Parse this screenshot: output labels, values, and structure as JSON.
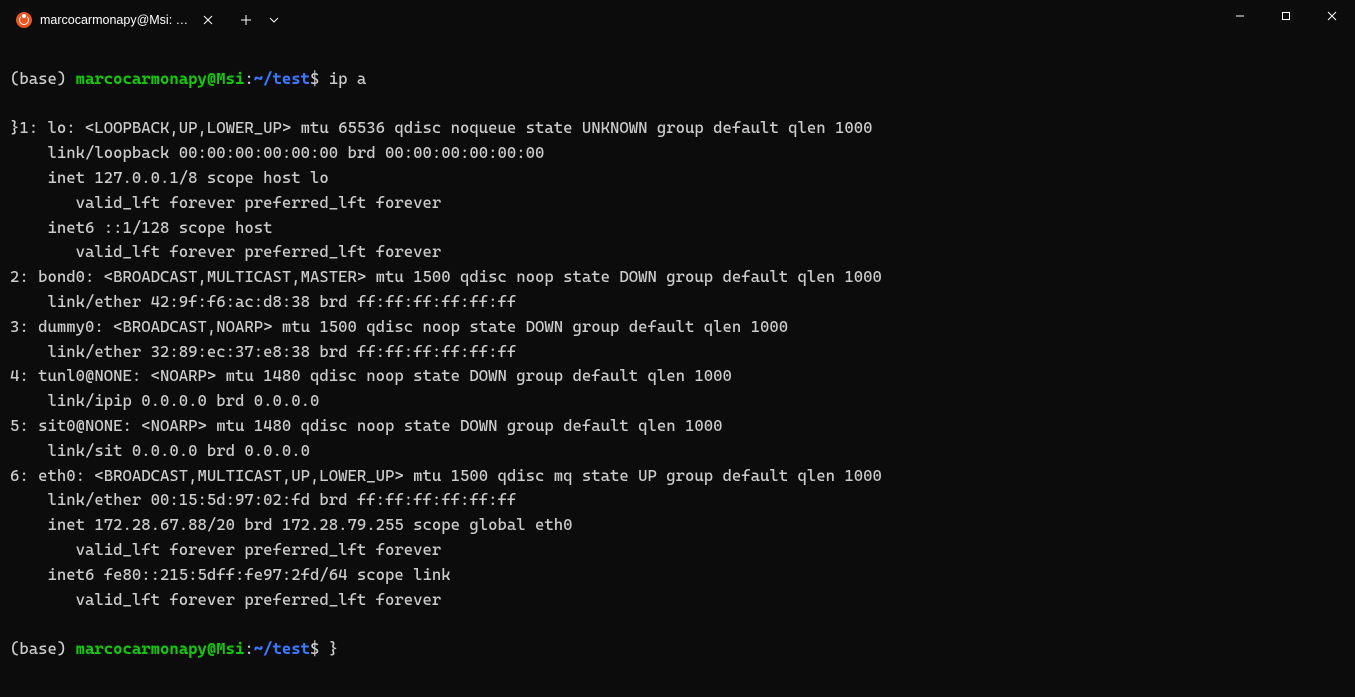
{
  "titlebar": {
    "tab_title": "marcocarmonapy@Msi: ~/tes"
  },
  "prompt1": {
    "base": "(base) ",
    "userhost": "marcocarmonapy@Msi",
    "colon": ":",
    "path": "~/test",
    "dollar": "$ ",
    "command": "ip a"
  },
  "output_lines": [
    "}1: lo: <LOOPBACK,UP,LOWER_UP> mtu 65536 qdisc noqueue state UNKNOWN group default qlen 1000",
    "    link/loopback 00:00:00:00:00:00 brd 00:00:00:00:00:00",
    "    inet 127.0.0.1/8 scope host lo",
    "       valid_lft forever preferred_lft forever",
    "    inet6 ::1/128 scope host",
    "       valid_lft forever preferred_lft forever",
    "2: bond0: <BROADCAST,MULTICAST,MASTER> mtu 1500 qdisc noop state DOWN group default qlen 1000",
    "    link/ether 42:9f:f6:ac:d8:38 brd ff:ff:ff:ff:ff:ff",
    "3: dummy0: <BROADCAST,NOARP> mtu 1500 qdisc noop state DOWN group default qlen 1000",
    "    link/ether 32:89:ec:37:e8:38 brd ff:ff:ff:ff:ff:ff",
    "4: tunl0@NONE: <NOARP> mtu 1480 qdisc noop state DOWN group default qlen 1000",
    "    link/ipip 0.0.0.0 brd 0.0.0.0",
    "5: sit0@NONE: <NOARP> mtu 1480 qdisc noop state DOWN group default qlen 1000",
    "    link/sit 0.0.0.0 brd 0.0.0.0",
    "6: eth0: <BROADCAST,MULTICAST,UP,LOWER_UP> mtu 1500 qdisc mq state UP group default qlen 1000",
    "    link/ether 00:15:5d:97:02:fd brd ff:ff:ff:ff:ff:ff",
    "    inet 172.28.67.88/20 brd 172.28.79.255 scope global eth0",
    "       valid_lft forever preferred_lft forever",
    "    inet6 fe80::215:5dff:fe97:2fd/64 scope link",
    "       valid_lft forever preferred_lft forever"
  ],
  "prompt2": {
    "base": "(base) ",
    "userhost": "marcocarmonapy@Msi",
    "colon": ":",
    "path": "~/test",
    "dollar": "$ ",
    "cursor": "}"
  }
}
